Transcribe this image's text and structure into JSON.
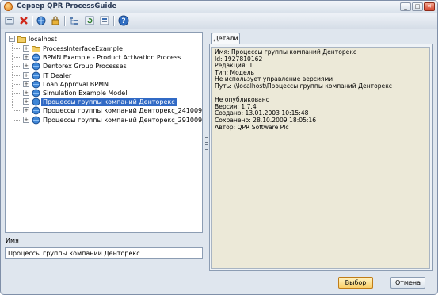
{
  "window": {
    "title": "Сервер QPR ProcessGuide"
  },
  "toolbar": {
    "icons": [
      "new-icon",
      "delete-icon",
      "connect-icon",
      "lock-icon",
      "tree-icon",
      "refresh-icon",
      "properties-icon",
      "help-icon"
    ]
  },
  "tree": {
    "root": "localhost",
    "items": [
      {
        "label": "ProcessInterfaceExample",
        "icon": "folder-icon"
      },
      {
        "label": "BPMN Example - Product Activation Process",
        "icon": "model-icon"
      },
      {
        "label": "Dentorex Group Processes",
        "icon": "model-icon"
      },
      {
        "label": "IT Dealer",
        "icon": "model-icon"
      },
      {
        "label": "Loan Approval BPMN",
        "icon": "model-icon"
      },
      {
        "label": "Simulation Example Model",
        "icon": "model-icon"
      },
      {
        "label": "Процессы группы компаний Денторекс",
        "icon": "model-icon",
        "selected": true
      },
      {
        "label": "Процессы группы компаний Денторекс_241009",
        "icon": "model-icon"
      },
      {
        "label": "Процессы группы компаний Денторекс_291009",
        "icon": "model-icon"
      }
    ]
  },
  "name_field": {
    "label": "Имя",
    "value": "Процессы группы компаний Денторекс"
  },
  "details": {
    "tab_label": "Детали",
    "lines": [
      "Имя: Процессы группы компаний Денторекс",
      "Id: 1927810162",
      "Редакция: 1",
      "Тип: Модель",
      "Не использует управление версиями",
      "Путь: \\\\localhost\\Процессы группы компаний Денторекс",
      "",
      "Не опубликовано",
      "Версия: 1.7.4",
      "Создано: 13.01.2003 10:15:48",
      "Сохранено: 28.10.2009 18:05:16",
      "Автор: QPR Software Plc"
    ]
  },
  "buttons": {
    "ok": "Выбор",
    "cancel": "Отмена"
  },
  "colors": {
    "selection": "#316ac5",
    "ok_button": "#fbd06a"
  }
}
